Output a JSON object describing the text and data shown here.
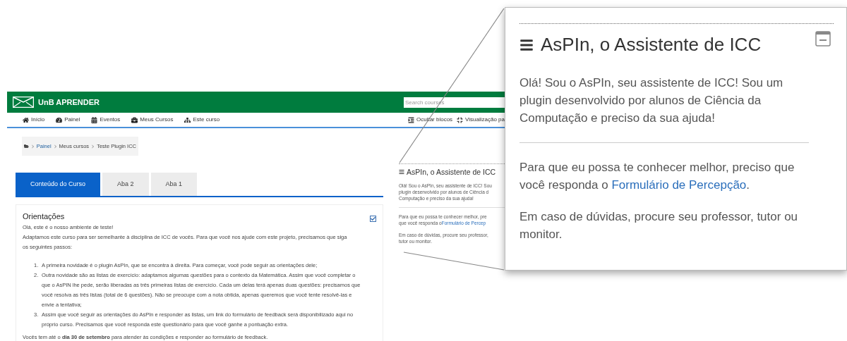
{
  "site": {
    "name": "UnB APRENDER",
    "search_placeholder": "Search courses"
  },
  "nav": [
    {
      "label": "Início"
    },
    {
      "label": "Painel"
    },
    {
      "label": "Eventos"
    },
    {
      "label": "Meus Cursos"
    },
    {
      "label": "Este curso"
    }
  ],
  "nav_right": [
    {
      "label": "Ocultar blocos"
    },
    {
      "label": "Visualização pa"
    }
  ],
  "breadcrumb": [
    {
      "label": "Painel",
      "kind": "link"
    },
    {
      "label": "Meus cursos",
      "kind": "text"
    },
    {
      "label": "Teste Plugin ICC",
      "kind": "text"
    }
  ],
  "tabs": [
    {
      "label": "Conteúdo do Curso",
      "selected": true
    },
    {
      "label": "Aba 2",
      "selected": false
    },
    {
      "label": "Aba 1",
      "selected": false
    }
  ],
  "section": {
    "title": "Orientações",
    "checked": true,
    "intro": [
      "Olá, este é o nosso ambiente de teste!",
      "Adaptamos este curso para ser semelhante à disciplina de ICC de vocês. Para que você nos ajude com este projeto, precisamos que siga os seguintes passos:"
    ],
    "steps": [
      {
        "number": "1.",
        "text": "A primeira novidade é o plugin AsPIn, que se encontra à direita. Para começar, você pode seguir as orientações dele;"
      },
      {
        "number": "2.",
        "text": "Outra novidade são as listas de exercício: adaptamos algumas questões para o contexto da Matemática. Assim que você completar o que o AsPIN lhe pede, serão liberadas as três primeiras listas de exercício. Cada um delas terá apenas duas questões: precisamos que você resolva as três listas (total de 6 questões). Não se preocupe com a nota obtida, apenas queremos que você tente resolvê-las e envie a tentativa;"
      },
      {
        "number": "3.",
        "text": "Assim que você seguir as orientações do AsPIn e responder as listas, um link do formulário de feedback será disponibilizado aqui no próprio curso. Precisamos que você responda este questionário para que você ganhe a pontuação extra."
      }
    ],
    "footer": "Vocês tem até o **dia 30 de setembro** para atender às condições e responder ao formulário de feedback."
  },
  "sidebar_block": {
    "title": "AsPIn, o Assistente de ICC",
    "paragraphs": [
      [
        {
          "text": "Olá! Sou o AsPIn, seu assistente de ICC! Sou"
        },
        {
          "text": "plugin desenvolvido por alunos de Ciência d"
        },
        {
          "text": "Computação e preciso da sua ajuda!"
        }
      ],
      [
        {
          "text": "Para que eu possa te conhecer melhor, pre"
        },
        {
          "text": "que você responda o ",
          "link": "Formulário de Percep"
        }
      ],
      [
        {
          "text": "Em caso de dúvidas, procure seu professor,"
        },
        {
          "text": "tutor ou monitor."
        }
      ]
    ]
  },
  "callout": {
    "title": "AsPIn, o Assistente de ICC",
    "paragraphs": [
      {
        "text": "Olá! Sou o AsPIn, seu assistente de ICC! Sou um plugin desenvolvido por alunos de Ciência da Computação e preciso da sua ajuda!"
      },
      {
        "text": "Para que eu possa te conhecer melhor, preciso que você responda o ",
        "link": "Formulário de Percepção",
        "after": "."
      },
      {
        "text": "Em caso de dúvidas, procure seu professor, tutor ou monitor."
      }
    ]
  }
}
